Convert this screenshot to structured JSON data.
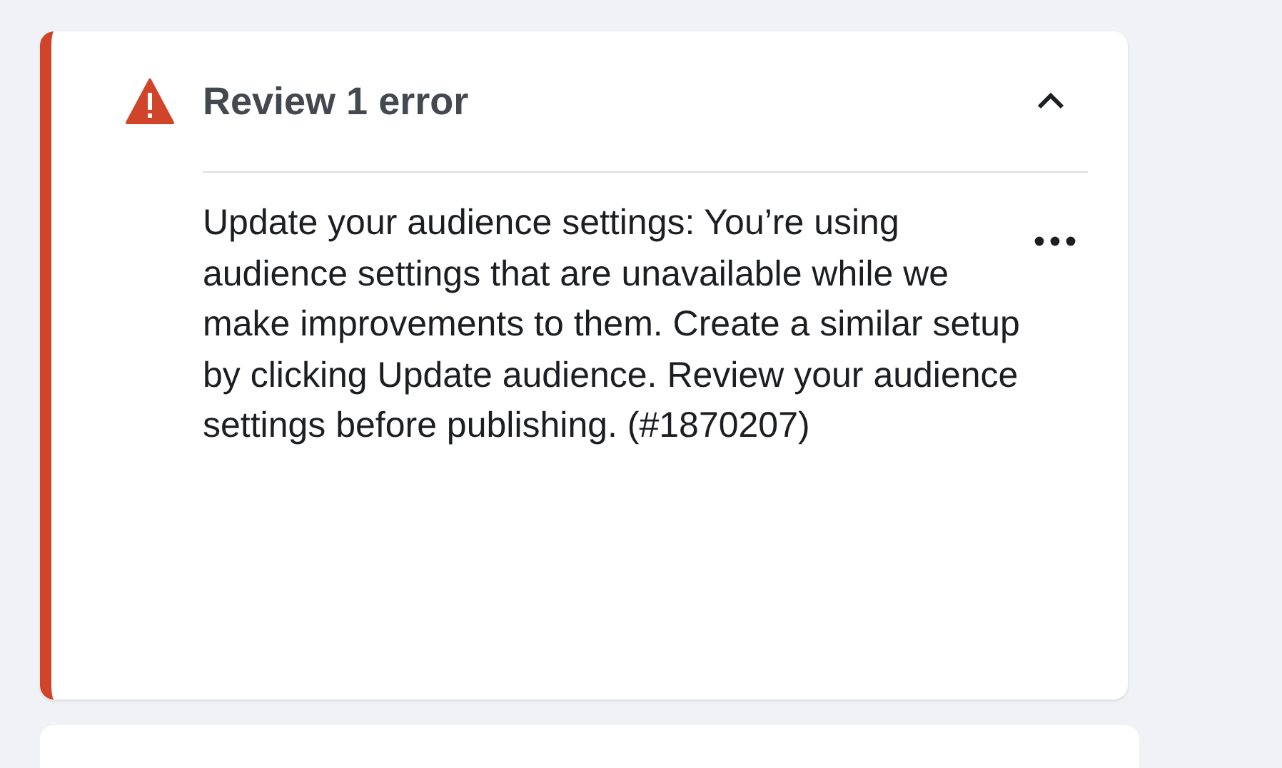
{
  "error_panel": {
    "title": "Review 1 error",
    "expanded": true,
    "message": "Update your audience settings: You’re using audience settings that are unavailable while we make improvements to them. Create a similar setup by clicking Update audience. Review your audience settings before publishing. (#1870207)"
  }
}
